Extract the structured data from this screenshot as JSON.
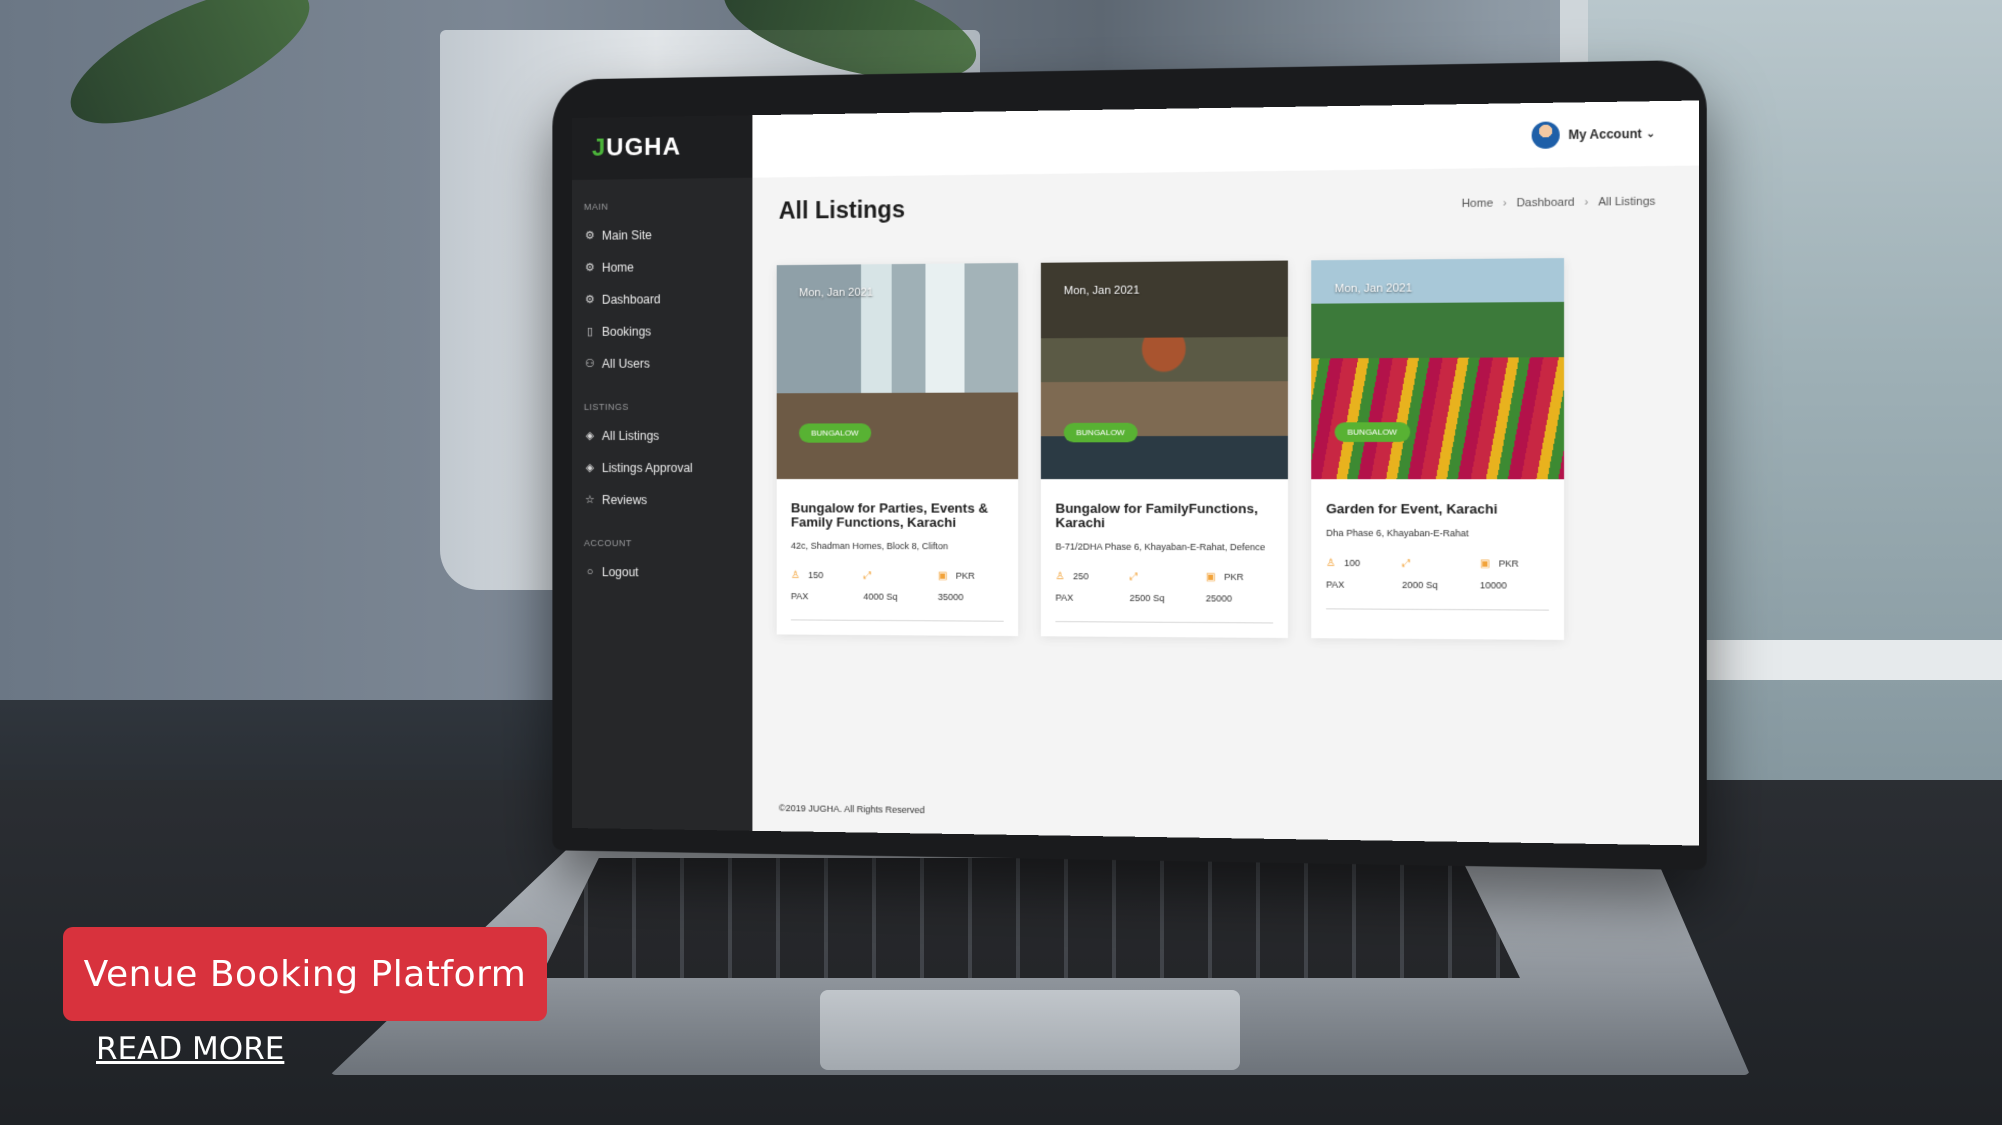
{
  "app": {
    "brand": "JUGHA",
    "brand_first_letter": "J",
    "brand_rest": "UGHA"
  },
  "sidebar": {
    "sections": [
      {
        "heading": "MAIN",
        "items": [
          {
            "label": "Main Site",
            "icon": "settings-icon"
          },
          {
            "label": "Home",
            "icon": "settings-icon"
          },
          {
            "label": "Dashboard",
            "icon": "settings-icon"
          },
          {
            "label": "Bookings",
            "icon": "document-icon"
          },
          {
            "label": "All Users",
            "icon": "user-icon"
          }
        ]
      },
      {
        "heading": "LISTINGS",
        "items": [
          {
            "label": "All Listings",
            "icon": "layers-icon"
          },
          {
            "label": "Listings Approval",
            "icon": "layers-icon"
          },
          {
            "label": "Reviews",
            "icon": "star-icon"
          }
        ]
      },
      {
        "heading": "ACCOUNT",
        "items": [
          {
            "label": "Logout",
            "icon": "power-icon"
          }
        ]
      }
    ]
  },
  "topbar": {
    "account_label": "My Account"
  },
  "page": {
    "title": "All Listings",
    "breadcrumb": [
      "Home",
      "Dashboard",
      "All Listings"
    ]
  },
  "listings": [
    {
      "date": "Mon, Jan 2021",
      "badge": "BUNGALOW",
      "title": "Bungalow for Parties, Events & Family Functions, Karachi",
      "address": "42c, Shadman Homes, Block 8, Clifton",
      "pax": "150",
      "pax_label": "PAX",
      "area": "4000 Sq",
      "currency": "PKR",
      "price": "35000",
      "image": "room-interior"
    },
    {
      "date": "Mon, Jan 2021",
      "badge": "BUNGALOW",
      "title": "Bungalow for FamilyFunctions, Karachi",
      "address": "B-71/2DHA Phase 6, Khayaban-E-Rahat, Defence",
      "pax": "250",
      "pax_label": "PAX",
      "area": "2500 Sq",
      "currency": "PKR",
      "price": "25000",
      "image": "house-on-shore"
    },
    {
      "date": "Mon, Jan 2021",
      "badge": "BUNGALOW",
      "title": "Garden for Event, Karachi",
      "address": "Dha Phase 6, Khayaban-E-Rahat",
      "pax": "100",
      "pax_label": "PAX",
      "area": "2000 Sq",
      "currency": "PKR",
      "price": "10000",
      "image": "flower-garden"
    }
  ],
  "footer": {
    "copyright": "©2019 JUGHA. All Rights Reserved"
  },
  "overlay": {
    "cta_label": "Venue Booking Platform",
    "read_more": "READ MORE",
    "cta_color": "#d8323d"
  },
  "colors": {
    "accent_green": "#58b233",
    "sidebar_bg": "#262729",
    "stat_icon": "#f2a33a"
  }
}
